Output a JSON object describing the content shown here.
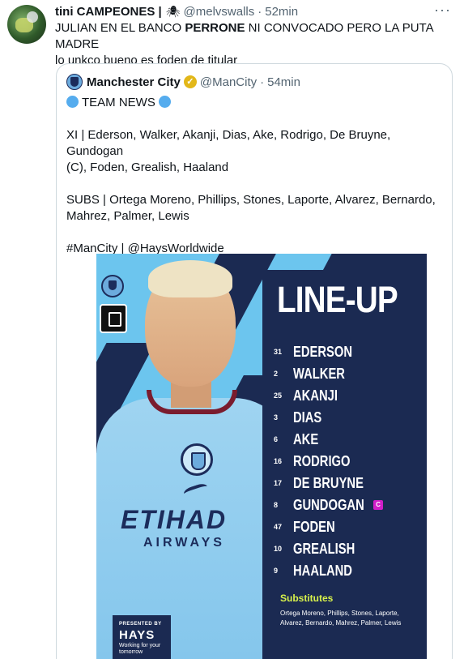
{
  "tweet": {
    "author": {
      "display_name": "tini CAMPEONES |",
      "spider_glyph": "🕷",
      "handle": "@melvswalls",
      "separator": "·",
      "time": "52min"
    },
    "more_glyph": "···",
    "text": {
      "part1": "JULIAN EN EL BANCO ",
      "bold": "PERRONE",
      "part2": " NI CONVOCADO PERO LA PUTA MADRE",
      "line2": "lo unkco bueno es foden de titular"
    }
  },
  "quote": {
    "author": {
      "display_name": "Manchester City",
      "verified_glyph": "✓",
      "handle": "@ManCity",
      "separator": "·",
      "time": "54min"
    },
    "lines": {
      "team_news": "TEAM NEWS",
      "xi_1": "XI | Ederson, Walker, Akanji, Dias, Ake, Rodrigo, De Bruyne, Gundogan",
      "xi_2": "(C), Foden, Grealish, Haaland",
      "subs_1": "SUBS | Ortega Moreno, Phillips, Stones, Laporte, Alvarez, Bernardo,",
      "subs_2": "Mahrez, Palmer, Lewis",
      "tags": "#ManCity | @HaysWorldwide"
    }
  },
  "graphic": {
    "title": "LINE-UP",
    "players": [
      {
        "number": "31",
        "name": "EDERSON"
      },
      {
        "number": "2",
        "name": "WALKER"
      },
      {
        "number": "25",
        "name": "AKANJI"
      },
      {
        "number": "3",
        "name": "DIAS"
      },
      {
        "number": "6",
        "name": "AKE"
      },
      {
        "number": "16",
        "name": "RODRIGO"
      },
      {
        "number": "17",
        "name": "DE BRUYNE"
      },
      {
        "number": "8",
        "name": "GUNDOGAN"
      },
      {
        "number": "47",
        "name": "FODEN"
      },
      {
        "number": "10",
        "name": "GREALISH"
      },
      {
        "number": "9",
        "name": "HAALAND"
      }
    ],
    "captain_mark": "C",
    "subs_label": "Substitutes",
    "subs_list": "Ortega Moreno, Phillips, Stones, Laporte, Alvarez, Bernardo, Mahrez, Palmer, Lewis",
    "jersey_sponsor_top": "ETIHAD",
    "jersey_sponsor_bottom": "AIRWAYS",
    "sponsor": {
      "presented": "PRESENTED BY",
      "name": "HAYS",
      "tagline": "Working for your tomorrow"
    },
    "colors": {
      "sky_blue": "#6cc5ee",
      "navy": "#1b2a52",
      "captain_magenta": "#d11ec8",
      "subs_yellow": "#d8f24b"
    }
  }
}
